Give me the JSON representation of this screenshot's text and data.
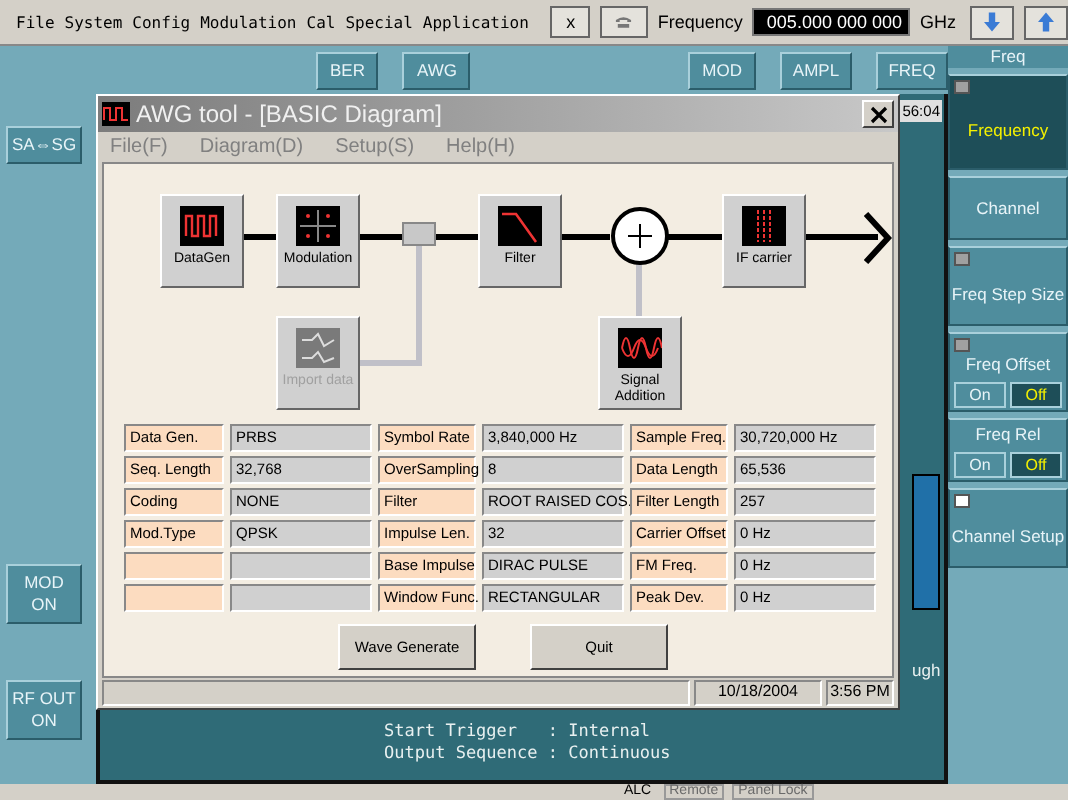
{
  "menu_bar": {
    "items": [
      "File",
      "System",
      "Config",
      "Modulation",
      "Cal",
      "Special",
      "Application"
    ],
    "close_button": "x",
    "frequency_label": "Frequency",
    "frequency_value": "005.000 000 000",
    "frequency_unit": "GHz"
  },
  "top_buttons": {
    "left": [
      "BER",
      "AWG"
    ],
    "right": [
      "MOD",
      "AMPL",
      "FREQ"
    ]
  },
  "left_buttons": {
    "top": [
      {
        "lines": [
          "SA⇔SG"
        ]
      }
    ],
    "bottom": [
      {
        "lines": [
          "MOD",
          "ON"
        ]
      },
      {
        "lines": [
          "RF OUT",
          "ON"
        ]
      }
    ]
  },
  "softkeys": {
    "title": "Freq",
    "items": [
      {
        "label": "Frequency",
        "kind": "plain",
        "selected": true,
        "indicator": {
          "color": "#a0a0a0"
        }
      },
      {
        "label": "Channel",
        "kind": "plain",
        "selected": false
      },
      {
        "label": "Freq Step Size",
        "kind": "plain",
        "selected": false,
        "indicator": {
          "color": "#a0a0a0"
        }
      },
      {
        "label": "Freq Offset",
        "kind": "toggle",
        "selected": false,
        "indicator": {
          "color": "#a0a0a0"
        },
        "options": [
          {
            "label": "On",
            "selected": false
          },
          {
            "label": "Off",
            "selected": true
          }
        ]
      },
      {
        "label": "Freq Rel",
        "kind": "toggle",
        "selected": false,
        "options": [
          {
            "label": "On",
            "selected": false
          },
          {
            "label": "Off",
            "selected": true
          }
        ]
      },
      {
        "label": "Channel Setup",
        "kind": "plain",
        "selected": false,
        "indicator": {
          "color": "#ffffff"
        }
      }
    ]
  },
  "screen": {
    "clock": "56:04",
    "side_text": "ugh",
    "lines": [
      "Start Trigger   : Internal",
      "Output Sequence : Continuous"
    ]
  },
  "dialog": {
    "title": "AWG tool - [BASIC Diagram]",
    "menu": [
      "File(F)",
      "Diagram(D)",
      "Setup(S)",
      "Help(H)"
    ],
    "blocks": [
      {
        "label": "DataGen",
        "kind": "datagen",
        "disabled": false
      },
      {
        "label": "Modulation",
        "kind": "modulation",
        "disabled": false
      },
      {
        "label": "Filter",
        "kind": "filter",
        "disabled": false
      },
      {
        "label": "IF carrier",
        "kind": "ifcarrier",
        "disabled": false
      },
      {
        "label": "Import data",
        "kind": "import",
        "disabled": true
      },
      {
        "label": "Signal Addition",
        "kind": "signal",
        "disabled": false
      }
    ],
    "table": [
      {
        "col_1": {
          "label": "Data Gen.",
          "value": "PRBS"
        },
        "col_2": {
          "label": "Symbol Rate",
          "value": "3,840,000 Hz"
        },
        "col_3": {
          "label": "Sample Freq.",
          "value": "30,720,000 Hz"
        }
      },
      {
        "col_1": {
          "label": "Seq. Length",
          "value": "32,768"
        },
        "col_2": {
          "label": "OverSampling",
          "value": "8"
        },
        "col_3": {
          "label": "Data Length",
          "value": "65,536"
        }
      },
      {
        "col_1": {
          "label": "Coding",
          "value": "NONE"
        },
        "col_2": {
          "label": "Filter",
          "value": "ROOT RAISED COS."
        },
        "col_3": {
          "label": "Filter Length",
          "value": "257"
        }
      },
      {
        "col_1": {
          "label": "Mod.Type",
          "value": "QPSK"
        },
        "col_2": {
          "label": "Impulse Len.",
          "value": "32"
        },
        "col_3": {
          "label": "Carrier Offset",
          "value": "0 Hz"
        }
      },
      {
        "col_2": {
          "label": "Base Impulse",
          "value": "DIRAC PULSE"
        },
        "col_3": {
          "label": "FM Freq.",
          "value": "0 Hz"
        }
      },
      {
        "col_2": {
          "label": "Window Func.",
          "value": "RECTANGULAR"
        },
        "col_3": {
          "label": "Peak Dev.",
          "value": "0 Hz"
        }
      }
    ],
    "buttons": [
      "Wave Generate",
      "Quit"
    ],
    "status": {
      "date": "10/18/2004",
      "time": "3:56 PM"
    }
  },
  "status_bar": [
    {
      "label": "ALC",
      "disabled": false
    },
    {
      "label": "Remote",
      "disabled": true
    },
    {
      "label": "Panel Lock",
      "disabled": true
    }
  ]
}
